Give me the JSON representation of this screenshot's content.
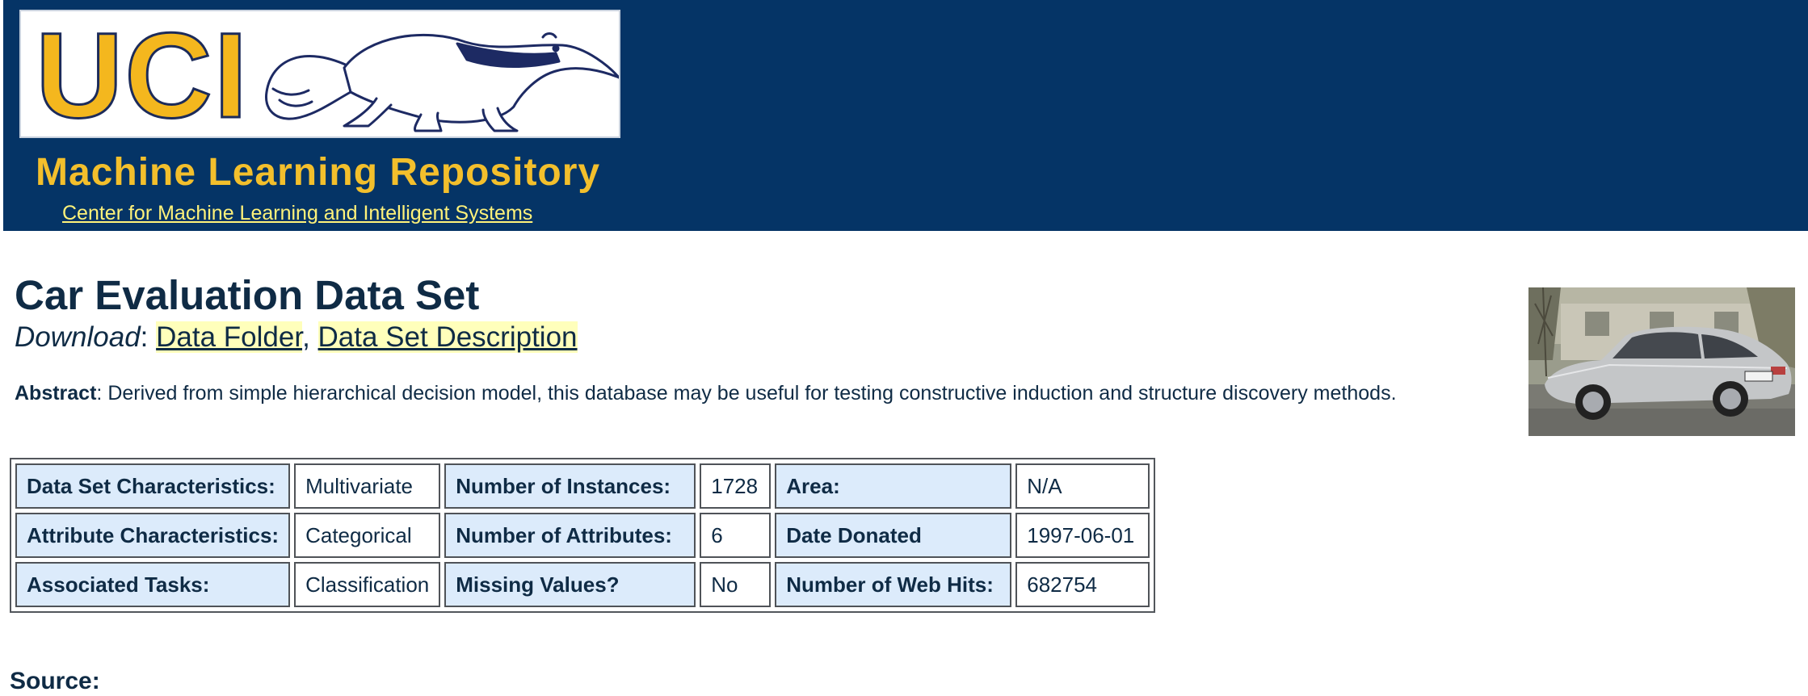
{
  "header": {
    "logo_text": "UCI",
    "repo_title": "Machine Learning Repository",
    "center_link": "Center for Machine Learning and Intelligent Systems",
    "background_color": "#053466",
    "accent_color": "#f3bf2c"
  },
  "dataset": {
    "title": "Car Evaluation Data Set",
    "download_label": "Download",
    "download_sep": ":",
    "links": {
      "data_folder": "Data Folder",
      "comma": ",",
      "description": "Data Set Description"
    },
    "abstract_label": "Abstract",
    "abstract_text": ": Derived from simple hierarchical decision model, this database may be useful for testing constructive induction and structure discovery methods.",
    "image_alt": "car photo"
  },
  "table": {
    "rows": [
      {
        "c1_label": "Data Set Characteristics:",
        "c1_value": "Multivariate",
        "c2_label": "Number of Instances:",
        "c2_value": "1728",
        "c3_label": "Area:",
        "c3_value": "N/A"
      },
      {
        "c1_label": "Attribute Characteristics:",
        "c1_value": "Categorical",
        "c2_label": "Number of Attributes:",
        "c2_value": "6",
        "c3_label": "Date Donated",
        "c3_value": "1997-06-01"
      },
      {
        "c1_label": "Associated Tasks:",
        "c1_value": "Classification",
        "c2_label": "Missing Values?",
        "c2_value": "No",
        "c3_label": "Number of Web Hits:",
        "c3_value": "682754"
      }
    ]
  },
  "source_heading": "Source:"
}
